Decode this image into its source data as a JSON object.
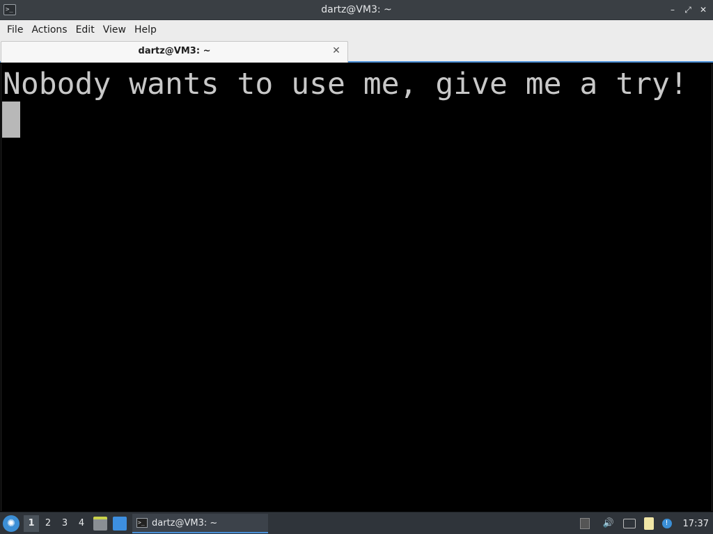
{
  "window": {
    "title": "dartz@VM3: ~",
    "controls": {
      "minimize": "–",
      "restore": "⤢",
      "close": "✕"
    }
  },
  "menubar": {
    "items": [
      {
        "label": "File"
      },
      {
        "label": "Actions"
      },
      {
        "label": "Edit"
      },
      {
        "label": "View"
      },
      {
        "label": "Help"
      }
    ]
  },
  "tabs": [
    {
      "label": "dartz@VM3: ~",
      "close": "✕"
    }
  ],
  "terminal": {
    "lines": [
      "Nobody wants to use me, give me a try!"
    ]
  },
  "taskbar": {
    "menu_icon": "lubuntu-logo-icon",
    "workspaces": [
      "1",
      "2",
      "3",
      "4"
    ],
    "active_workspace": "1",
    "task": {
      "label": "dartz@VM3: ~"
    },
    "tray": {
      "volume_glyph": "🔊",
      "info_glyph": "!",
      "clock": "17:37"
    }
  },
  "colors": {
    "titlebar": "#3a3f44",
    "terminal_bg": "#000000",
    "terminal_fg": "#c8c8c8",
    "accent": "#4a90d9"
  }
}
